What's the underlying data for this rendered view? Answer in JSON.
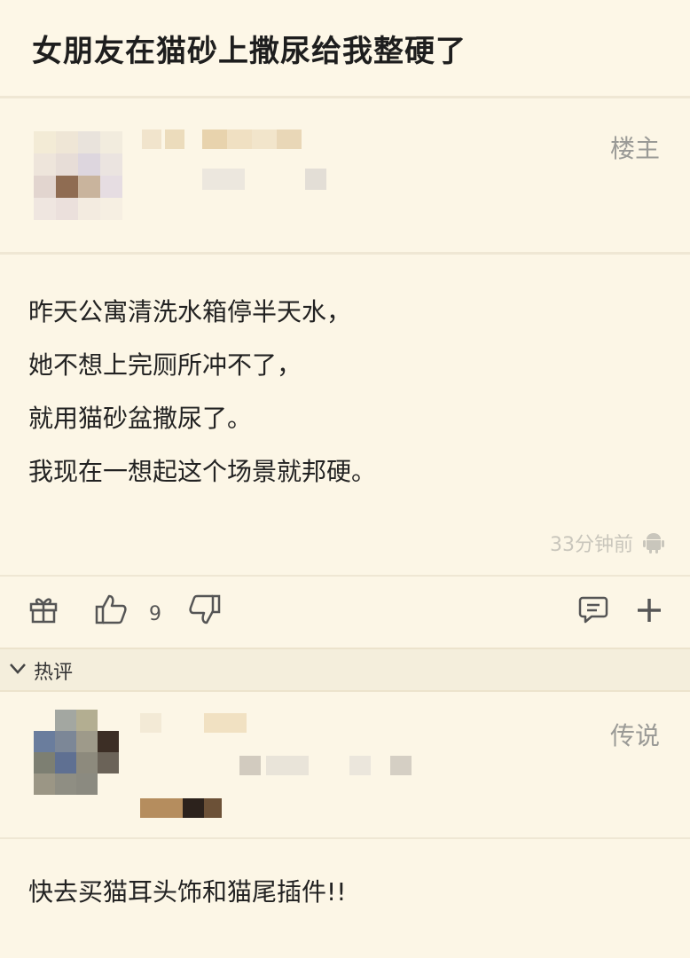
{
  "post": {
    "title": "女朋友在猫砂上撒尿给我整硬了",
    "author_badge": "楼主",
    "body_lines": [
      "昨天公寓清洗水箱停半天水，",
      "她不想上完厕所冲不了，",
      "就用猫砂盆撒尿了。",
      "我现在一想起这个场景就邦硬。"
    ],
    "timestamp": "33分钟前",
    "device_icon": "android-icon"
  },
  "actions": {
    "gift_icon": "gift-icon",
    "like_icon": "thumbs-up-icon",
    "like_count": "9",
    "dislike_icon": "thumbs-down-icon",
    "comment_icon": "comment-icon",
    "add_icon": "plus-icon"
  },
  "hot_comments": {
    "label": "热评",
    "toggle_icon": "chevron-down-icon"
  },
  "comment": {
    "author_badge": "传说",
    "body": "快去买猫耳头饰和猫尾插件!!"
  },
  "colors": {
    "background": "#fcf6e6",
    "hot_bar": "#f4eedc",
    "muted_text": "#9a9a96"
  }
}
